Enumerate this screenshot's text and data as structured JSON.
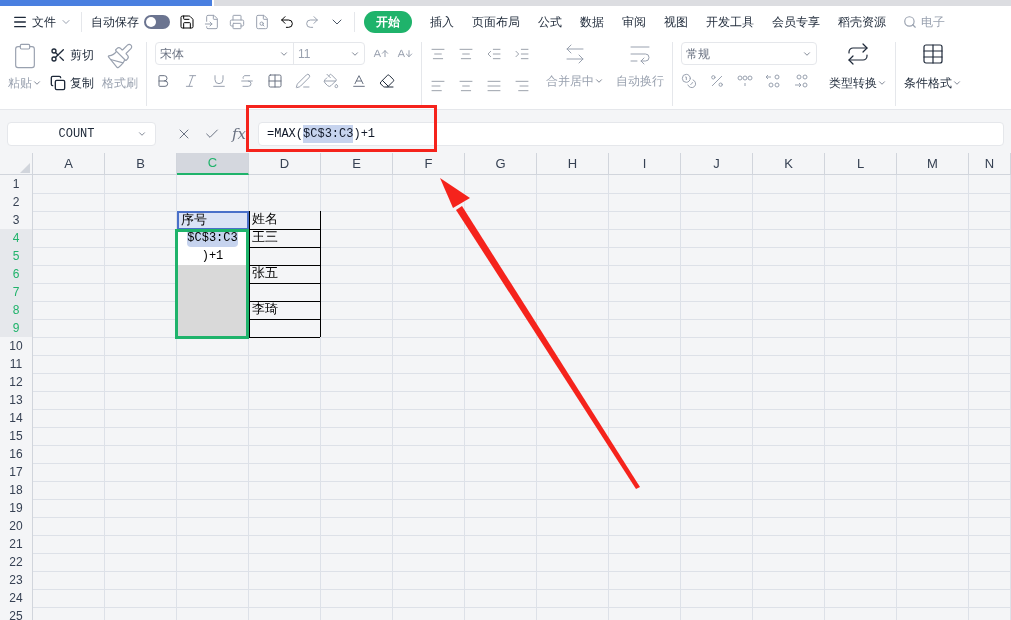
{
  "menu": {
    "file": "文件",
    "autosave": {
      "label": "自动保存",
      "on": false
    },
    "tabs": [
      {
        "label": "开始",
        "selected": true
      },
      {
        "label": "插入",
        "selected": false
      },
      {
        "label": "页面布局",
        "selected": false
      },
      {
        "label": "公式",
        "selected": false
      },
      {
        "label": "数据",
        "selected": false
      },
      {
        "label": "审阅",
        "selected": false
      },
      {
        "label": "视图",
        "selected": false
      },
      {
        "label": "开发工具",
        "selected": false
      },
      {
        "label": "会员专享",
        "selected": false
      },
      {
        "label": "稻壳资源",
        "selected": false
      }
    ],
    "search": {
      "placeholder": "电子"
    }
  },
  "ribbon": {
    "paste": {
      "label": "粘贴",
      "disabled": true
    },
    "cut": {
      "label": "剪切",
      "disabled": false
    },
    "copy": {
      "label": "复制",
      "disabled": false
    },
    "format_painter": {
      "label": "格式刷",
      "disabled": true
    },
    "font": {
      "name": "宋体",
      "size": "11"
    },
    "merge": {
      "label": "合并居中",
      "disabled": true
    },
    "wrap": {
      "label": "自动换行",
      "disabled": true
    },
    "number_format": "常规",
    "convert": {
      "label": "类型转换",
      "disabled": false
    },
    "conditional_format": {
      "label": "条件格式",
      "disabled": false
    }
  },
  "formula_bar": {
    "name_box": "COUNT",
    "function_label": "fx",
    "parts": [
      {
        "text": "=MAX(",
        "highlighted": false
      },
      {
        "text": "$C$3:C3",
        "highlighted": true
      },
      {
        "text": ")+1",
        "highlighted": false
      }
    ]
  },
  "sheet": {
    "columns": [
      {
        "label": "A",
        "selected": false
      },
      {
        "label": "B",
        "selected": false
      },
      {
        "label": "C",
        "selected": true
      },
      {
        "label": "D",
        "selected": false
      },
      {
        "label": "E",
        "selected": false
      },
      {
        "label": "F",
        "selected": false
      },
      {
        "label": "G",
        "selected": false
      },
      {
        "label": "H",
        "selected": false
      },
      {
        "label": "I",
        "selected": false
      },
      {
        "label": "J",
        "selected": false
      },
      {
        "label": "K",
        "selected": false
      },
      {
        "label": "L",
        "selected": false
      },
      {
        "label": "M",
        "selected": false
      },
      {
        "label": "N",
        "selected": false
      }
    ],
    "rows": [
      {
        "label": "1",
        "selected": false,
        "cells": []
      },
      {
        "label": "2",
        "selected": false,
        "cells": []
      },
      {
        "label": "3",
        "selected": false,
        "cells": [
          {},
          {},
          {
            "kind": "active",
            "text": "序号"
          },
          {
            "kind": "bordered",
            "text": "姓名"
          }
        ]
      },
      {
        "label": "4",
        "selected": true,
        "cells": [
          {},
          {},
          {
            "kind": "edit",
            "text": "$C$3:C3",
            "highlighted": true
          },
          {
            "kind": "bordered",
            "text": "王三"
          }
        ]
      },
      {
        "label": "5",
        "selected": true,
        "cells": [
          {},
          {},
          {
            "kind": "edit",
            "text": ")+1",
            "highlighted": false
          },
          {
            "kind": "bordered"
          }
        ]
      },
      {
        "label": "6",
        "selected": true,
        "cells": [
          {},
          {},
          {
            "kind": "filled"
          },
          {
            "kind": "bordered",
            "text": "张五"
          }
        ]
      },
      {
        "label": "7",
        "selected": true,
        "cells": [
          {},
          {},
          {
            "kind": "filled"
          },
          {
            "kind": "bordered"
          }
        ]
      },
      {
        "label": "8",
        "selected": true,
        "cells": [
          {},
          {},
          {
            "kind": "filled"
          },
          {
            "kind": "bordered",
            "text": "李琦"
          }
        ]
      },
      {
        "label": "9",
        "selected": true,
        "cells": [
          {},
          {},
          {
            "kind": "filled"
          },
          {
            "kind": "bordered"
          }
        ]
      },
      {
        "label": "10",
        "selected": false,
        "cells": []
      },
      {
        "label": "11",
        "selected": false,
        "cells": []
      },
      {
        "label": "12",
        "selected": false,
        "cells": []
      },
      {
        "label": "13",
        "selected": false,
        "cells": []
      },
      {
        "label": "14",
        "selected": false,
        "cells": []
      },
      {
        "label": "15",
        "selected": false,
        "cells": []
      },
      {
        "label": "16",
        "selected": false,
        "cells": []
      },
      {
        "label": "17",
        "selected": false,
        "cells": []
      },
      {
        "label": "18",
        "selected": false,
        "cells": []
      },
      {
        "label": "19",
        "selected": false,
        "cells": []
      },
      {
        "label": "20",
        "selected": false,
        "cells": []
      },
      {
        "label": "21",
        "selected": false,
        "cells": []
      },
      {
        "label": "22",
        "selected": false,
        "cells": []
      },
      {
        "label": "23",
        "selected": false,
        "cells": []
      },
      {
        "label": "24",
        "selected": false,
        "cells": []
      },
      {
        "label": "25",
        "selected": false,
        "cells": []
      }
    ]
  },
  "annotations": {
    "frame": true,
    "arrow": true
  }
}
